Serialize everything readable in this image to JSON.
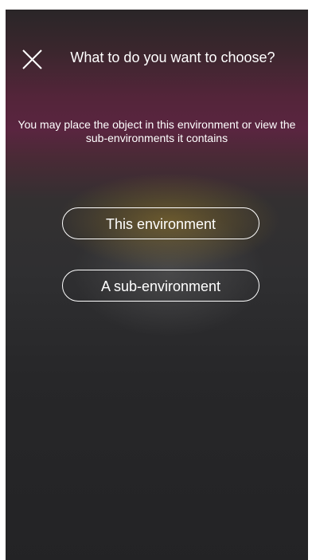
{
  "dialog": {
    "close_icon": "close-x-icon",
    "title": "What to do you want to choose?",
    "subtitle": "You may place the object in this environment or view the sub-environments it contains"
  },
  "options": {
    "this_environment": "This environment",
    "sub_environment": "A sub-environment"
  },
  "colors": {
    "text": "#ffffff",
    "background_dark": "#232325",
    "accent_magenta": "#5a2540"
  }
}
